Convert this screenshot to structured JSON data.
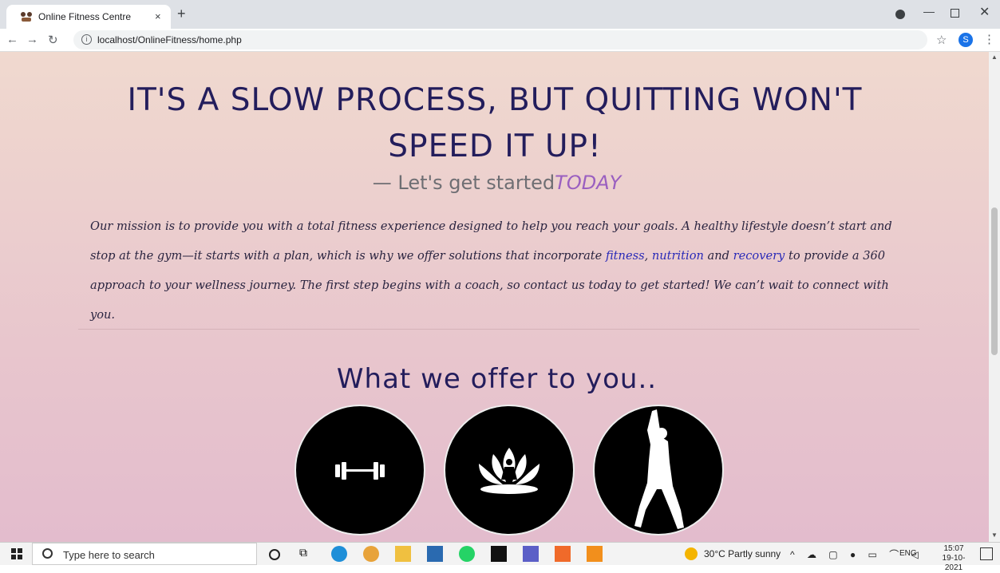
{
  "browser": {
    "tab_title": "Online Fitness Centre",
    "tab_close": "×",
    "new_tab": "+",
    "url": "localhost/OnlineFitness/home.php",
    "profile_initial": "S",
    "info_glyph": "i"
  },
  "page": {
    "heading": "IT'S A SLOW PROCESS, BUT QUITTING WON'T SPEED IT UP!",
    "tagline_prefix": "— Let's get started",
    "tagline_emphasis": "TODAY",
    "mission_part1": "Our mission is to provide you with a total fitness experience designed to help you reach your goals. A healthy lifestyle doesn’t start and stop at the gym—it starts with a plan, which is why we offer solutions that incorporate ",
    "mission_link1": "fitness",
    "mission_sep1": ", ",
    "mission_link2": "nutrition",
    "mission_sep2": " and ",
    "mission_link3": "recovery",
    "mission_part2": " to provide a 360 approach to your wellness journey. The first step begins with a coach, so contact us today to get started! We can’t wait to connect with you.",
    "offer_title": "What we offer to you..",
    "offers": [
      {
        "icon": "dumbbell-icon"
      },
      {
        "icon": "lotus-meditation-icon"
      },
      {
        "icon": "dancer-silhouette-icon"
      }
    ]
  },
  "taskbar": {
    "search_placeholder": "Type here to search",
    "weather": "30°C  Partly sunny",
    "tray_icons": "^ ☁ ▢ ● ▭ ⌒ ◁",
    "language": "ENG",
    "time": "15:07",
    "date": "19-10-2021"
  },
  "colors": {
    "heading": "#231d5c",
    "accent_today": "#9a5fc0",
    "link": "#2a2ab8"
  }
}
